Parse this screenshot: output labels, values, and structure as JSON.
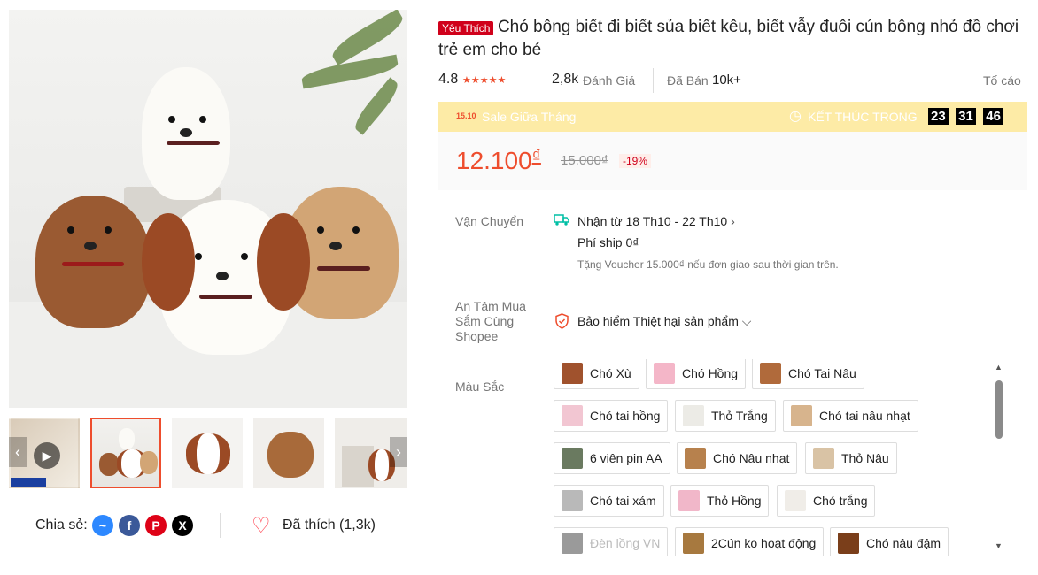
{
  "product": {
    "badge": "Yêu Thích",
    "title": "Chó bông biết đi biết sủa biết kêu, biết vẫy đuôi cún bông nhỏ đồ chơi trẻ em cho bé"
  },
  "stats": {
    "rating": "4.8",
    "stars": 5,
    "review_count": "2,8k",
    "review_label": "Đánh Giá",
    "sold_label": "Đã Bán",
    "sold_count": "10k+",
    "report_label": "Tố cáo"
  },
  "flash_sale": {
    "tag": "15.10",
    "name": "Sale Giữa Tháng",
    "ends_label": "KẾT THÚC TRONG",
    "hours": "23",
    "minutes": "31",
    "seconds": "46"
  },
  "price": {
    "current": "12.100",
    "currency": "₫",
    "original": "15.000₫",
    "discount": "-19%"
  },
  "shipping": {
    "label": "Vận Chuyển",
    "delivery": "Nhận từ 18 Th10 - 22 Th10",
    "fee": "Phí ship 0₫",
    "voucher": "Tặng Voucher 15.000₫ nếu đơn giao sau thời gian trên."
  },
  "guarantee": {
    "label": "An Tâm Mua Sắm Cùng Shopee",
    "text": "Bảo hiểm Thiệt hại sản phẩm"
  },
  "variants": {
    "label": "Màu Sắc",
    "options": [
      {
        "name": "Chó Xù",
        "color": "#a0522d"
      },
      {
        "name": "Chó Hồng",
        "color": "#f4b6c8"
      },
      {
        "name": "Chó Tai Nâu",
        "color": "#b06a3b"
      },
      {
        "name": "Chó tai hồng",
        "color": "#f2c6d2"
      },
      {
        "name": "Thỏ Trắng",
        "color": "#ecebe6"
      },
      {
        "name": "Chó tai nâu nhạt",
        "color": "#d7b48d"
      },
      {
        "name": "6 viên pin AA",
        "color": "#6a7a60"
      },
      {
        "name": "Chó Nâu nhạt",
        "color": "#b7814d"
      },
      {
        "name": "Thỏ Nâu",
        "color": "#d9c3a5"
      },
      {
        "name": "Chó tai xám",
        "color": "#b9b9b9"
      },
      {
        "name": "Thỏ Hồng",
        "color": "#f1b7c9"
      },
      {
        "name": "Chó trắng",
        "color": "#f0ede8"
      },
      {
        "name": "Đèn lồng VN",
        "color": "#9a9a9a"
      },
      {
        "name": "2Cún ko hoạt động",
        "color": "#a7793f"
      },
      {
        "name": "Chó nâu đậm",
        "color": "#7a3e1a"
      }
    ]
  },
  "share": {
    "label": "Chia sẻ:",
    "networks": [
      "messenger",
      "facebook",
      "pinterest",
      "x"
    ]
  },
  "like": {
    "label": "Đã thích (1,3k)"
  },
  "thumbnails": [
    "video-thumb",
    "dogs-group",
    "brown-white-dog",
    "curly-dog",
    "box-dog"
  ],
  "colors": {
    "accent": "#ee4d2d",
    "sale_bg": "#fdeba6",
    "price_bg": "#fafafa",
    "badge": "#d0011b"
  }
}
